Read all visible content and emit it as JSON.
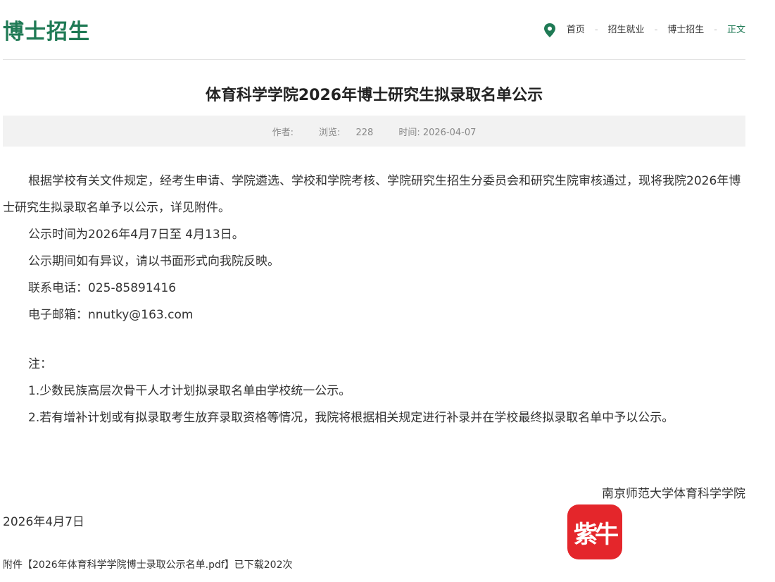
{
  "header": {
    "section_title": "博士招生",
    "breadcrumb": {
      "items": [
        "首页",
        "招生就业",
        "博士招生"
      ],
      "current": "正文",
      "separator": "-"
    }
  },
  "article": {
    "title": "体育科学学院2026年博士研究生拟录取名单公示",
    "meta": {
      "author_label": "作者:",
      "views_label": "浏览:",
      "views": "228",
      "time_label": "时间:",
      "time": "2026-04-07"
    },
    "paragraphs": [
      "根据学校有关文件规定，经考生申请、学院遴选、学校和学院考核、学院研究生招生分委员会和研究生院审核通过，现将我院2026年博士研究生拟录取名单予以公示，详见附件。",
      "公示时间为2026年4月7日至 4月13日。",
      "公示期间如有异议，请以书面形式向我院反映。",
      "联系电话：025-85891416",
      "电子邮箱：nnutky@163.com"
    ],
    "note_heading": " 注：",
    "notes": [
      "1.少数民族高层次骨干人才计划拟录取名单由学校统一公示。",
      "2.若有增补计划或有拟录取考生放弃录取资格等情况，我院将根据相关规定进行补录并在学校最终拟录取名单中予以公示。"
    ],
    "signature": "南京师范大学体育科学学院",
    "date": "2026年4月7日",
    "attachment": "附件【2026年体育科学学院博士录取公示名单.pdf】已下载202次"
  },
  "logo": {
    "text": "紫牛",
    "color": "#e4262b"
  },
  "colors": {
    "accent": "#1f7a55",
    "meta_bg": "#f2f2f2"
  }
}
